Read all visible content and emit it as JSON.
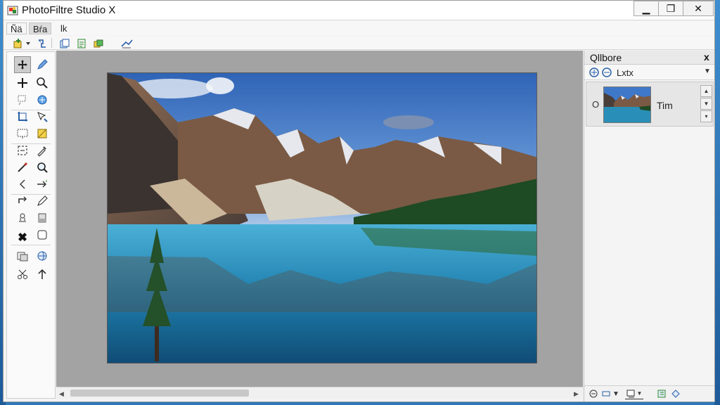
{
  "window": {
    "title": "PhotoFiltre Studio X",
    "controls": {
      "minimize": "▁",
      "maximize": "❐",
      "close": "✕"
    }
  },
  "menubar": {
    "items": [
      {
        "label": "Ñä"
      },
      {
        "label": "Bŕa"
      },
      {
        "label": "lk"
      }
    ]
  },
  "toolbar": {
    "icons": [
      "new-layer-icon",
      "dropdown-arrow-icon",
      "transform-icon",
      "copy-icon",
      "paste-icon",
      "layers-icon",
      "adjust-icon"
    ]
  },
  "toolbox": {
    "tools": [
      "move-tool-icon",
      "pencil-icon",
      "crosshair-icon",
      "zoom-icon",
      "lasso-icon",
      "magic-wand-icon",
      "crop-icon",
      "selection-icon",
      "screen-select-icon",
      "fill-icon",
      "transform-icon",
      "eyedropper-icon",
      "brush-icon",
      "magnifier-icon",
      "arrow-left-icon",
      "arrows-icon",
      "rotate-icon",
      "pen-icon",
      "stamp-icon",
      "eraser-icon",
      "gear-icon",
      "smudge-icon",
      "copy-tool-icon",
      "globe-icon",
      "scissors-icon",
      "arrow-up-icon"
    ]
  },
  "layers_panel": {
    "title": "Qllbore",
    "close_label": "x",
    "toolbar_label": "Lxtx",
    "layer": {
      "name": "Tim"
    }
  },
  "colors": {
    "accent": "#2e78b8",
    "workspace": "#a3a3a3",
    "sky": "#3f78c8",
    "lake": "#2a8fb8"
  }
}
